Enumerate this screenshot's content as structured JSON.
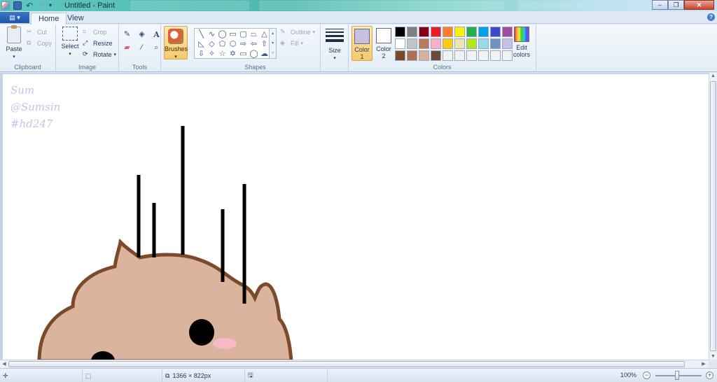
{
  "window": {
    "title": "Untitled - Paint"
  },
  "quick_access": {
    "icons": [
      "paint-app-icon",
      "save-icon",
      "undo-icon",
      "redo-icon"
    ]
  },
  "tabs": [
    {
      "label": "Home",
      "active": true
    },
    {
      "label": "View",
      "active": false
    }
  ],
  "ribbon": {
    "clipboard": {
      "label": "Clipboard",
      "paste": "Paste",
      "cut": "Cut",
      "copy": "Copy"
    },
    "image": {
      "label": "Image",
      "select": "Select",
      "crop": "Crop",
      "resize": "Resize",
      "rotate": "Rotate"
    },
    "tools": {
      "label": "Tools"
    },
    "brushes": {
      "label": "Brushes"
    },
    "shapes": {
      "label": "Shapes",
      "outline": "Outline",
      "fill": "Fill"
    },
    "size": {
      "label": "Size"
    },
    "colors": {
      "label": "Colors",
      "color1": {
        "label": "Color",
        "num": "1",
        "value": "#c8c0e0"
      },
      "color2": {
        "label": "Color",
        "num": "2",
        "value": "#ffffff"
      },
      "edit": {
        "label": "Edit",
        "label2": "colors"
      },
      "palette": [
        "#000000",
        "#7f7f7f",
        "#880015",
        "#ed1c24",
        "#ff7f27",
        "#fff200",
        "#22b14c",
        "#00a2e8",
        "#3f48cc",
        "#a349a4",
        "#ffffff",
        "#c3c3c3",
        "#b97a57",
        "#ffaec9",
        "#ffc90e",
        "#efe4b0",
        "#b5e61d",
        "#99d9ea",
        "#7092be",
        "#c8bfe7",
        "#7a4a2a",
        "#b07050",
        "#d9b09a",
        "#6b4a38",
        "#f2f2f2",
        "#f2f2f2",
        "#f2f2f2",
        "#f2f2f2",
        "#f2f2f2",
        "#f2f2f2"
      ]
    }
  },
  "canvas": {
    "watermark": [
      "Sum",
      "@Sumsin",
      "#hd247"
    ],
    "drawing": {
      "body_color": "#dbb49e",
      "outline_color": "#7a4a2a",
      "blush_color": "#f7b8c8",
      "line_color": "#000000"
    }
  },
  "status": {
    "dimensions": "1366 × 822px",
    "zoom": "100%"
  }
}
